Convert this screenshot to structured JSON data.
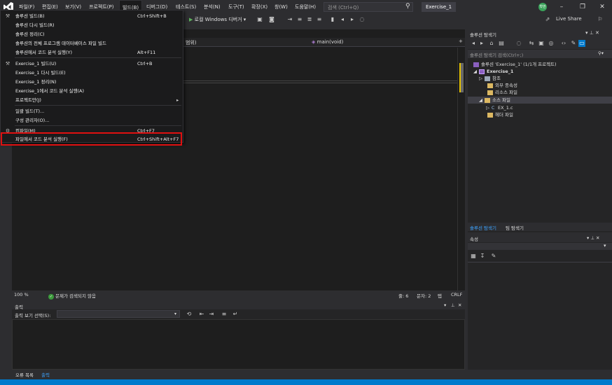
{
  "menubar": {
    "items": [
      "파일(F)",
      "편집(E)",
      "보기(V)",
      "프로젝트(P)",
      "빌드(B)",
      "디버그(D)",
      "테스트(S)",
      "분석(N)",
      "도구(T)",
      "확장(X)",
      "창(W)",
      "도움말(H)"
    ],
    "search_placeholder": "검색 (Ctrl+Q)",
    "window_title": "Exercise_1",
    "avatar_text": "학번"
  },
  "toolbar": {
    "run_label": "로컬 Windows 디버거",
    "live_share": "Live Share"
  },
  "editor": {
    "scope": "범위)",
    "function": "main(void)",
    "zoom": "100 %",
    "issues": "문제가 검색되지 않음",
    "line": "줄: 6",
    "col": "문자: 2",
    "tab": "탭",
    "eol": "CRLF"
  },
  "build_menu": {
    "items": [
      {
        "label": "솔루션 빌드(B)",
        "shortcut": "Ctrl+Shift+B",
        "icon": "build-icon"
      },
      {
        "label": "솔루션 다시 빌드(R)",
        "shortcut": "",
        "icon": ""
      },
      {
        "label": "솔루션 정리(C)",
        "shortcut": "",
        "icon": ""
      },
      {
        "label": "솔루션의 전체 프로그램 데이터베이스 파일 빌드",
        "shortcut": "",
        "icon": ""
      },
      {
        "label": "솔루션에서 코드 분석 실행(Y)",
        "shortcut": "Alt+F11",
        "icon": ""
      },
      {
        "label": "Exercise_1 빌드(U)",
        "shortcut": "Ctrl+B",
        "icon": "build-icon"
      },
      {
        "label": "Exercise_1 다시 빌드(E)",
        "shortcut": "",
        "icon": ""
      },
      {
        "label": "Exercise_1 정리(N)",
        "shortcut": "",
        "icon": ""
      },
      {
        "label": "Exercise_1에서 코드 분석 실행(A)",
        "shortcut": "",
        "icon": ""
      },
      {
        "label": "프로젝트만(J)",
        "shortcut": "",
        "icon": ""
      },
      {
        "label": "일괄 빌드(T)...",
        "shortcut": "",
        "icon": ""
      },
      {
        "label": "구성 관리자(O)...",
        "shortcut": "",
        "icon": ""
      },
      {
        "label": "컴파일(M)",
        "shortcut": "Ctrl+F7",
        "icon": "compile-icon"
      },
      {
        "label": "파일에서 코드 분석 실행(F)",
        "shortcut": "Ctrl+Shift+Alt+F7",
        "icon": ""
      }
    ]
  },
  "output": {
    "title": "출력",
    "source_label": "출력 보기 선택(S):",
    "tabs": [
      "오류 목록",
      "출력"
    ]
  },
  "solution_explorer": {
    "title": "솔루션 탐색기",
    "search": "솔루션 탐색기 검색(Ctrl+;)",
    "tree": [
      {
        "label": "솔루션 'Exercise_1' (1/1개 프로젝트)",
        "level": 0,
        "icon": "solution-icon"
      },
      {
        "label": "Exercise_1",
        "level": 1,
        "icon": "project-icon",
        "bold": true
      },
      {
        "label": "참조",
        "level": 2,
        "icon": "references-icon"
      },
      {
        "label": "외부 종속성",
        "level": 2,
        "icon": "folder-icon"
      },
      {
        "label": "리소스 파일",
        "level": 2,
        "icon": "folder-icon"
      },
      {
        "label": "소스 파일",
        "level": 2,
        "icon": "folder-icon",
        "selected": true
      },
      {
        "label": "EX_1.c",
        "level": 3,
        "icon": "c-file-icon"
      },
      {
        "label": "헤더 파일",
        "level": 2,
        "icon": "folder-icon"
      }
    ],
    "tabs": [
      "솔루션 탐색기",
      "팀 탐색기"
    ]
  },
  "properties": {
    "title": "속성"
  }
}
